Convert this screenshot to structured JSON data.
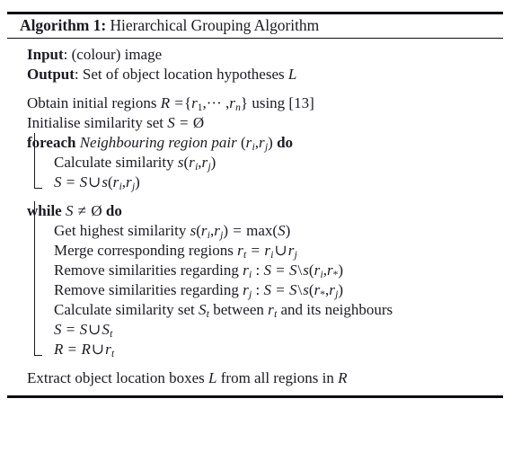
{
  "figure": {
    "label": "Algorithm 1:",
    "title": "Hierarchical Grouping Algorithm",
    "io": {
      "input_label": "Input",
      "input_value": ": (colour) image",
      "output_label": "Output",
      "output_value": ": Set of object location hypotheses",
      "output_var": "L"
    },
    "lines": {
      "obtain_regions": {
        "text_1": "Obtain initial regions",
        "var_R": "R",
        "eq": "=",
        "set_open": "{",
        "var_r": "r",
        "sub_1": "1",
        "dots": ",··· ,",
        "var_r2": "r",
        "sub_n": "n",
        "set_close": "}",
        "text_2": "using [13]"
      },
      "init_similarity": {
        "text_1": "Initialise similarity set",
        "var_S": "S",
        "eq": "=",
        "empty": "Ø"
      },
      "foreach": {
        "kw": "foreach",
        "em": "Neighbouring region pair",
        "paren_open": "(",
        "var_ri": "r",
        "sub_i": "i",
        "comma": ",",
        "var_rj": "r",
        "sub_j": "j",
        "paren_close": ")",
        "kw_do": "do"
      },
      "calc_similarity": {
        "text": "Calculate similarity",
        "fn": "s",
        "paren_open": "(",
        "var_ri": "r",
        "sub_i": "i",
        "comma": ",",
        "var_rj": "r",
        "sub_j": "j",
        "paren_close": ")"
      },
      "s_union": {
        "var_S": "S",
        "eq": "=",
        "var_S2": "S",
        "cup": "∪",
        "fn": "s",
        "paren_open": "(",
        "var_ri": "r",
        "sub_i": "i",
        "comma": ",",
        "var_rj": "r",
        "sub_j": "j",
        "paren_close": ")"
      },
      "while": {
        "kw": "while",
        "var_S": "S",
        "neq": "≠",
        "empty": "Ø",
        "kw_do": "do"
      },
      "get_highest": {
        "text": "Get highest similarity",
        "fn": "s",
        "paren_open": "(",
        "var_ri": "r",
        "sub_i": "i",
        "comma": ",",
        "var_rj": "r",
        "sub_j": "j",
        "paren_close": ")",
        "eq": "=",
        "max": "max",
        "max_open": "(",
        "var_S": "S",
        "max_close": ")"
      },
      "merge": {
        "text": "Merge corresponding regions",
        "var_rt": "r",
        "sub_t": "t",
        "eq": "=",
        "var_ri": "r",
        "sub_i": "i",
        "cup": "∪",
        "var_rj": "r",
        "sub_j": "j"
      },
      "remove_i": {
        "text": "Remove similarities regarding",
        "var_ri": "r",
        "sub_i": "i",
        "colon": ":",
        "var_S": "S",
        "eq": "=",
        "var_S2": "S",
        "setminus": "\\",
        "fn": "s",
        "paren_open": "(",
        "var_ri2": "r",
        "sub_i2": "i",
        "comma": ",",
        "var_rstar": "r",
        "sub_star": "*",
        "paren_close": ")"
      },
      "remove_j": {
        "text": "Remove similarities regarding",
        "var_rj": "r",
        "sub_j": "j",
        "colon": ":",
        "var_S": "S",
        "eq": "=",
        "var_S2": "S",
        "setminus": "\\",
        "fn": "s",
        "paren_open": "(",
        "var_rstar": "r",
        "sub_star": "*",
        "comma": ",",
        "var_rj2": "r",
        "sub_j2": "j",
        "paren_close": ")"
      },
      "calc_set": {
        "text_1": "Calculate similarity set",
        "var_St": "S",
        "sub_t": "t",
        "text_2": "between",
        "var_rt": "r",
        "sub_t2": "t",
        "text_3": "and its neighbours"
      },
      "s_union_st": {
        "var_S": "S",
        "eq": "=",
        "var_S2": "S",
        "cup": "∪",
        "var_St": "S",
        "sub_t": "t"
      },
      "r_union_rt": {
        "var_R": "R",
        "eq": "=",
        "var_R2": "R",
        "cup": "∪",
        "var_rt": "r",
        "sub_t": "t"
      },
      "extract": {
        "text_1": "Extract object location boxes",
        "var_L": "L",
        "text_2": "from all regions in",
        "var_R": "R"
      }
    }
  }
}
